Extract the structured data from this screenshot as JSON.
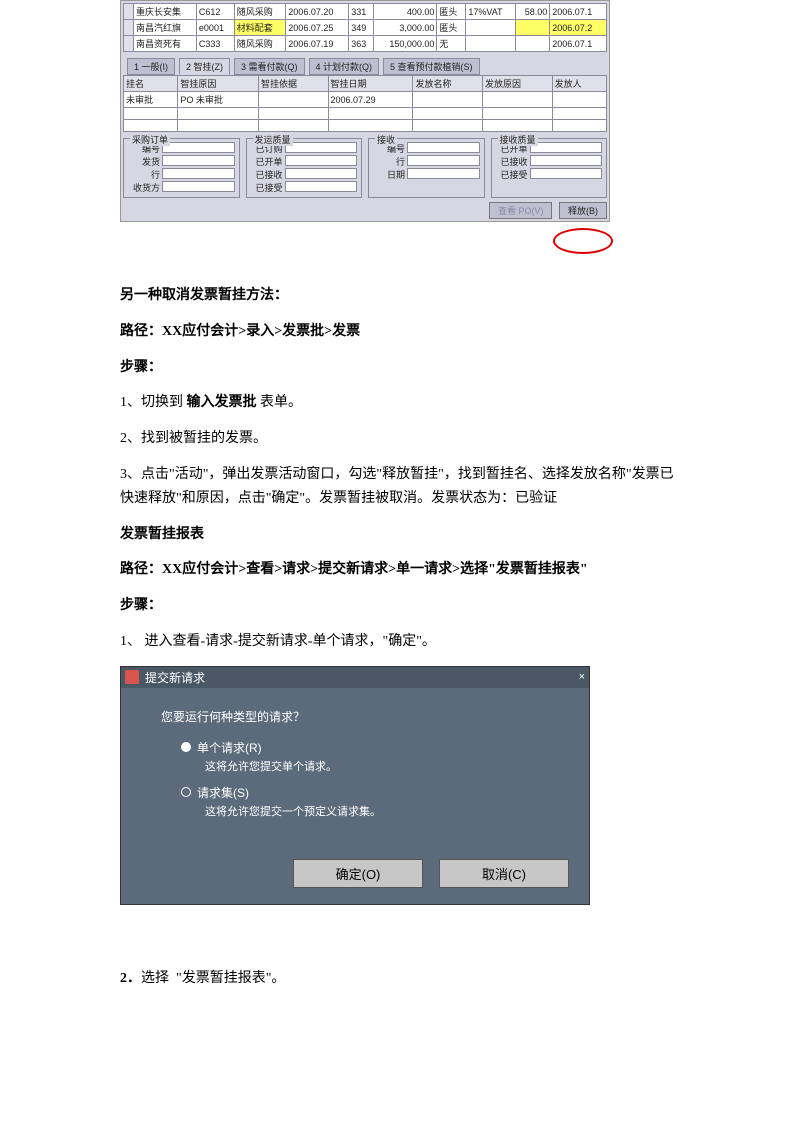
{
  "erp1": {
    "rows": [
      {
        "c0": "",
        "c1": "重庆长安集",
        "c2": "C612",
        "c3": "随风采购",
        "c4": "2006.07.20",
        "c5": "331",
        "c6": "400.00",
        "c7": "匿头",
        "c8": "17%VAT",
        "c9": "58.00",
        "c10": "2006.07.1"
      },
      {
        "c0": "",
        "c1": "南昌汽红旗",
        "c2": "e0001",
        "c3": "材料配套",
        "c4": "2006.07.25",
        "c5": "349",
        "c6": "3,000.00",
        "c7": "匿头",
        "c8": "",
        "c9": "",
        "c10": "2006.07.2"
      },
      {
        "c0": "",
        "c1": "南昌资死有",
        "c2": "C333",
        "c3": "随风采购",
        "c4": "2006.07.19",
        "c5": "363",
        "c6": "150,000.00",
        "c7": "无",
        "c8": "",
        "c9": "",
        "c10": "2006.07.1"
      }
    ],
    "tabs": [
      "1 一般(I)",
      "2 智挂(Z)",
      "3 需看付款(Q)",
      "4 计划付款(Q)",
      "5 查看预付款植销(S)"
    ],
    "sub_headers": [
      "挂名",
      "智挂原因",
      "智挂依据",
      "智挂日期",
      "发放名称",
      "发放原因",
      "发放人"
    ],
    "sub_row": {
      "name": "未审批",
      "reason": "PO 未审批",
      "date": "2006.07.29"
    },
    "panels": {
      "p1": {
        "title": "采购订单",
        "rows": [
          "编号",
          "发货",
          "行",
          "收货方"
        ]
      },
      "p2": {
        "title": "发运质量",
        "rows": [
          "已订购",
          "已开单",
          "已接收",
          "已接受"
        ]
      },
      "p3": {
        "title": "接收",
        "rows": [
          "编号",
          "行",
          "日期"
        ]
      },
      "p4": {
        "title": "接收质量",
        "rows": [
          "已开单",
          "已接收",
          "已接受"
        ]
      }
    },
    "bottom": {
      "btn1": "查看 PO(V)",
      "btn2": "释放(B)"
    }
  },
  "text": {
    "h1": "另一种取消发票暂挂方法：",
    "path1": "路径：XX应付会计>录入>发票批>发票",
    "steps_label": "步骤：",
    "s1": "1、切换到 ",
    "s1b": "输入发票批",
    "s1c": " 表单。",
    "s2": "2、找到被暂挂的发票。",
    "s3": "3、点击\"活动\"，弹出发票活动窗口，勾选\"释放暂挂\"，找到暂挂名、选择发放名称\"发票已快速释放\"和原因，点击\"确定\"。发票暂挂被取消。发票状态为：已验证",
    "h2": "发票暂挂报表",
    "path2": "路径：XX应付会计>查看>请求>提交新请求>单一请求>选择\"发票暂挂报表\"",
    "steps_label2": "步骤：",
    "s4": "1、 进入查看-请求-提交新请求-单个请求，\"确定\"。",
    "s5a": "2．",
    "s5b": "选择  \"发票暂挂报表\"。"
  },
  "dialog": {
    "title": "提交新请求",
    "close_x": "×",
    "question": "您要运行何种类型的请求？",
    "opt1": "单个请求(R)",
    "opt1_desc": "这将允许您提交单个请求。",
    "opt2": "请求集(S)",
    "opt2_desc": "这将允许您提交一个预定义请求集。",
    "ok": "确定(O)",
    "cancel": "取消(C)"
  }
}
